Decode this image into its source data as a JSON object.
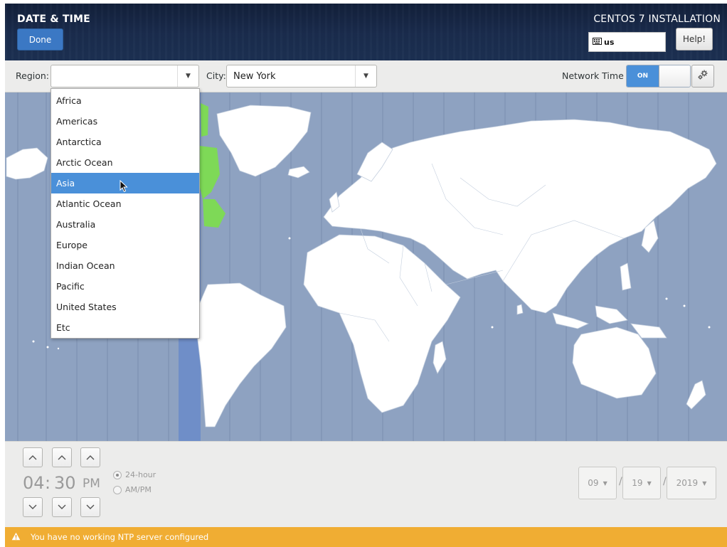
{
  "header": {
    "page_title": "DATE & TIME",
    "done_label": "Done",
    "install_title": "CENTOS 7 INSTALLATION",
    "keyboard_layout": "us",
    "help_label": "Help!"
  },
  "toolbar": {
    "region_label": "Region:",
    "region_value": "",
    "city_label": "City:",
    "city_value": "New York",
    "network_time_label": "Network Time",
    "network_time_state": "ON"
  },
  "region_dropdown": {
    "items": [
      "Africa",
      "Americas",
      "Antarctica",
      "Arctic Ocean",
      "Asia",
      "Atlantic Ocean",
      "Australia",
      "Europe",
      "Indian Ocean",
      "Pacific",
      "United States",
      "Etc"
    ],
    "highlighted": "Asia"
  },
  "time": {
    "hours": "04",
    "separator": ":",
    "minutes": "30",
    "period": "PM",
    "format_24h_label": "24-hour",
    "format_ampm_label": "AM/PM",
    "selected_format": "24-hour"
  },
  "date": {
    "month": "09",
    "day": "19",
    "year": "2019",
    "separator": "/"
  },
  "warning": {
    "message": "You have no working NTP server configured"
  },
  "colors": {
    "accent": "#4a90d9",
    "header_bg": "#1a2c4d",
    "map_ocean": "#8ea2c1",
    "map_land": "#ffffff",
    "timezone_highlight": "#7ed957",
    "warning_bg": "#f0ad33"
  }
}
